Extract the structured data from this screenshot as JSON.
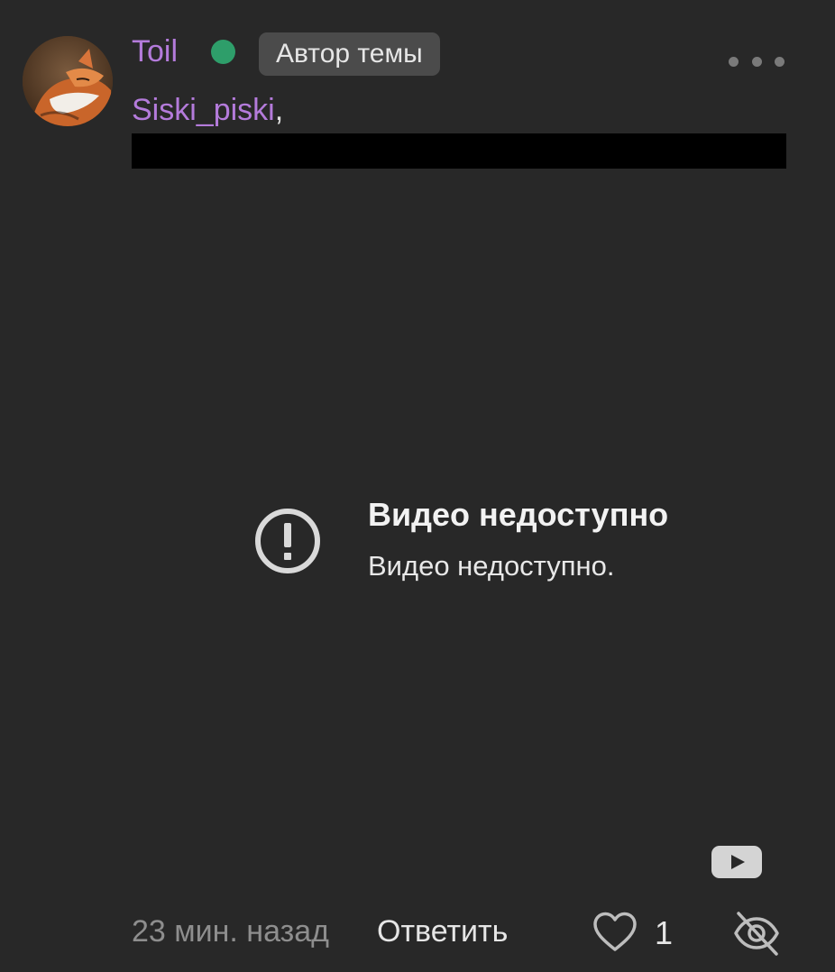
{
  "post": {
    "author": {
      "name": "Toil",
      "online_status_color": "#2e9e6a",
      "badge": "Автор темы",
      "avatar": "fox-avatar"
    },
    "mention": {
      "username": "Siski_piski",
      "suffix": ","
    },
    "video": {
      "error_title": "Видео недоступно",
      "error_message": "Видео недоступно.",
      "error_icon": "error-icon",
      "provider_icon": "youtube-icon"
    },
    "footer": {
      "timestamp": "23 мин. назад",
      "reply_label": "Ответить",
      "like_icon": "heart-icon",
      "like_count": "1",
      "hide_icon": "eye-slash-icon"
    }
  },
  "colors": {
    "background": "#282828",
    "accent_username": "#b47bdb",
    "badge_bg": "#4b4b4b",
    "muted_text": "#8e8e8e"
  }
}
